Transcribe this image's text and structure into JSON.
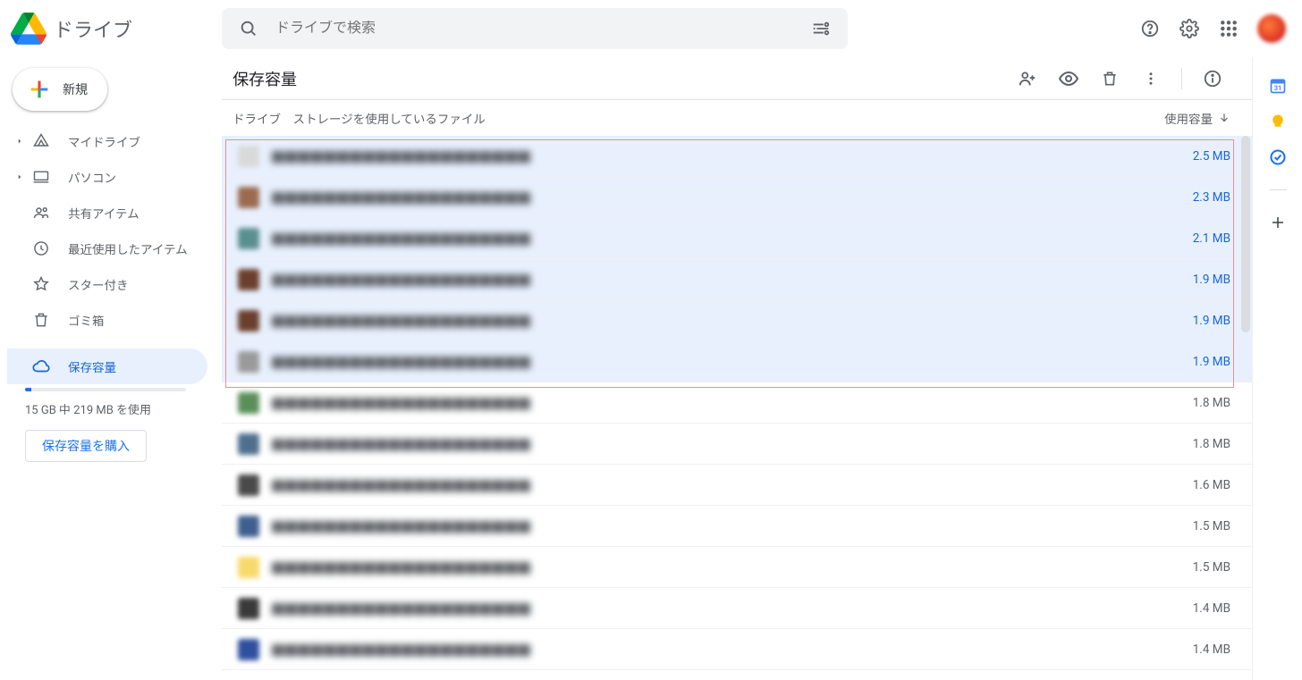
{
  "brand": {
    "name": "ドライブ"
  },
  "search": {
    "placeholder": "ドライブで検索"
  },
  "sidebar": {
    "new_label": "新規",
    "items": [
      {
        "label": "マイドライブ",
        "icon": "mydrive",
        "expandable": true
      },
      {
        "label": "パソコン",
        "icon": "computer",
        "expandable": true
      },
      {
        "label": "共有アイテム",
        "icon": "shared",
        "expandable": false
      },
      {
        "label": "最近使用したアイテム",
        "icon": "recent",
        "expandable": false
      },
      {
        "label": "スター付き",
        "icon": "star",
        "expandable": false
      },
      {
        "label": "ゴミ箱",
        "icon": "trash",
        "expandable": false
      },
      {
        "label": "保存容量",
        "icon": "cloud",
        "expandable": false,
        "active": true
      }
    ],
    "storage_text": "15 GB 中 219 MB を使用",
    "buy_label": "保存容量を購入"
  },
  "main": {
    "title": "保存容量",
    "col_name": "ドライブ　ストレージを使用しているファイル",
    "col_size": "使用容量",
    "rows": [
      {
        "size": "2.5 MB",
        "selected": true,
        "thumb": "#d9d9d9"
      },
      {
        "size": "2.3 MB",
        "selected": true,
        "thumb": "#9b6b4f"
      },
      {
        "size": "2.1 MB",
        "selected": true,
        "thumb": "#5a8f8f"
      },
      {
        "size": "1.9 MB",
        "selected": true,
        "thumb": "#6b3f2e"
      },
      {
        "size": "1.9 MB",
        "selected": true,
        "thumb": "#6b3f2e"
      },
      {
        "size": "1.9 MB",
        "selected": true,
        "thumb": "#9a9a9a"
      },
      {
        "size": "1.8 MB",
        "selected": false,
        "thumb": "#5a8f5a"
      },
      {
        "size": "1.8 MB",
        "selected": false,
        "thumb": "#4f6f8f"
      },
      {
        "size": "1.6 MB",
        "selected": false,
        "thumb": "#4a4a4a"
      },
      {
        "size": "1.5 MB",
        "selected": false,
        "thumb": "#3f5f8f"
      },
      {
        "size": "1.5 MB",
        "selected": false,
        "thumb": "#f7d96b"
      },
      {
        "size": "1.4 MB",
        "selected": false,
        "thumb": "#3a3a3a"
      },
      {
        "size": "1.4 MB",
        "selected": false,
        "thumb": "#2f4f9f"
      }
    ]
  }
}
